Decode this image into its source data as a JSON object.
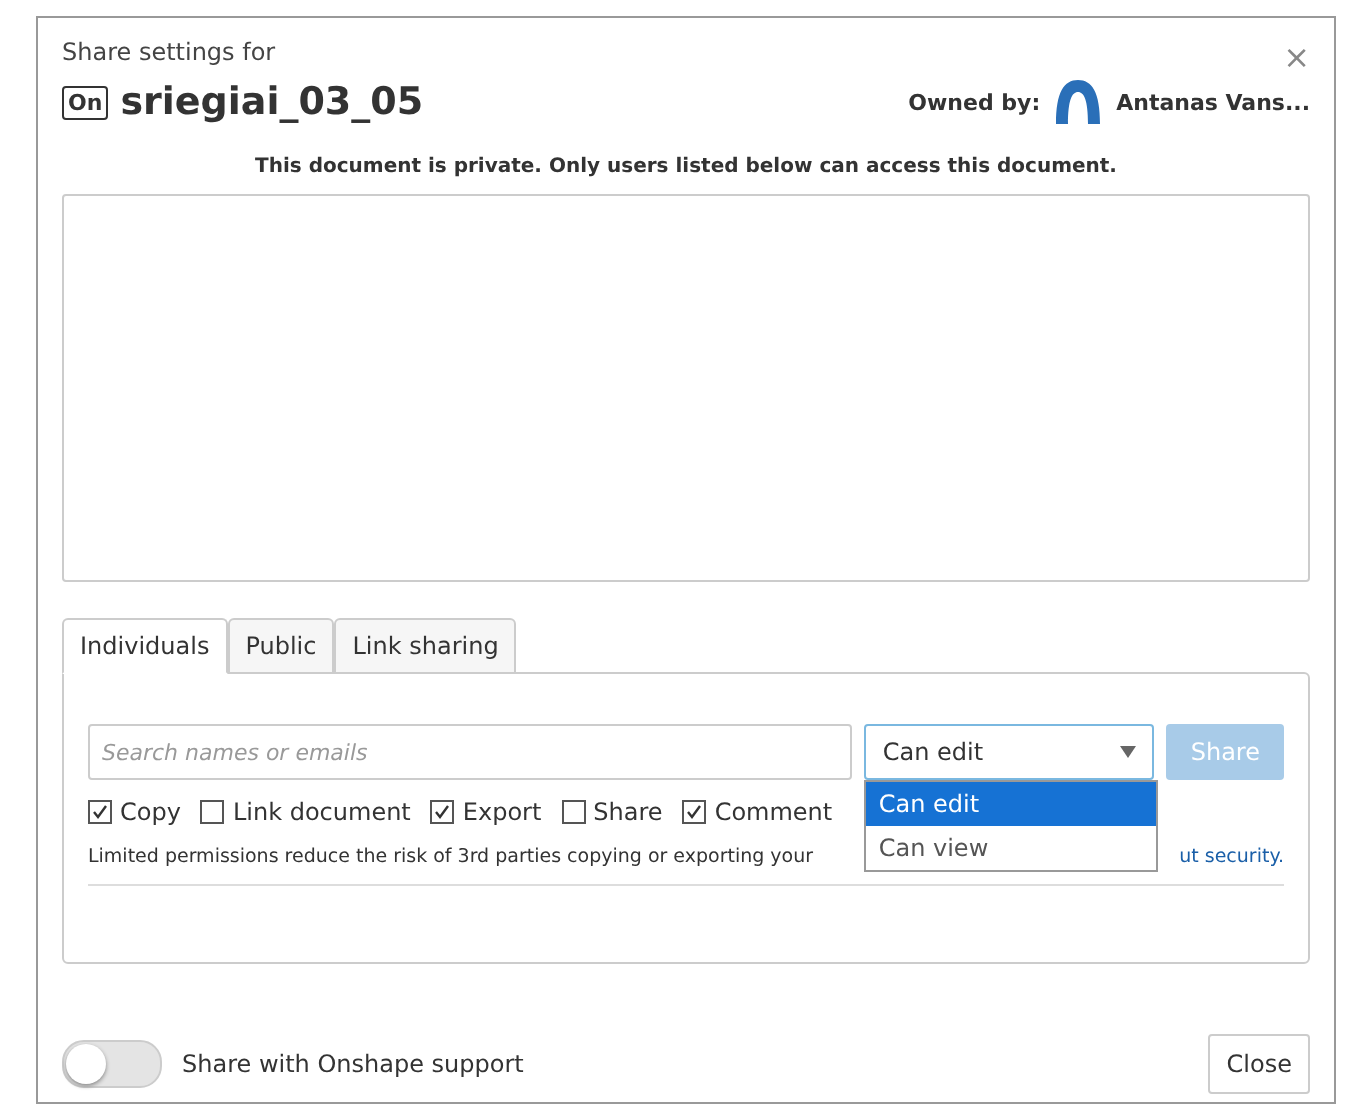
{
  "dialog": {
    "subtitle": "Share settings for",
    "close_icon": "×",
    "doc_badge": "On",
    "title": "sriegiai_03_05",
    "owner_label": "Owned by:",
    "owner_name": "Antanas Vans..."
  },
  "notice": "This document is private. Only users listed below can access this document.",
  "tabs": [
    {
      "label": "Individuals",
      "selected": true
    },
    {
      "label": "Public",
      "selected": false
    },
    {
      "label": "Link sharing",
      "selected": false
    }
  ],
  "search": {
    "placeholder": "Search names or emails"
  },
  "permission_select": {
    "value": "Can edit",
    "expanded": true,
    "options": [
      {
        "label": "Can edit",
        "selected": true
      },
      {
        "label": "Can view",
        "selected": false
      }
    ]
  },
  "share_button": {
    "label": "Share",
    "disabled": true
  },
  "permissions": [
    {
      "label": "Copy",
      "checked": true
    },
    {
      "label": "Link document",
      "checked": false
    },
    {
      "label": "Export",
      "checked": true
    },
    {
      "label": "Share",
      "checked": false
    },
    {
      "label": "Comment",
      "checked": true
    }
  ],
  "info": {
    "text": "Limited permissions reduce the risk of 3rd parties copying or exporting your",
    "link": "ut security."
  },
  "footer": {
    "support_toggle": {
      "label": "Share with Onshape support",
      "on": false
    },
    "close_button": "Close"
  }
}
